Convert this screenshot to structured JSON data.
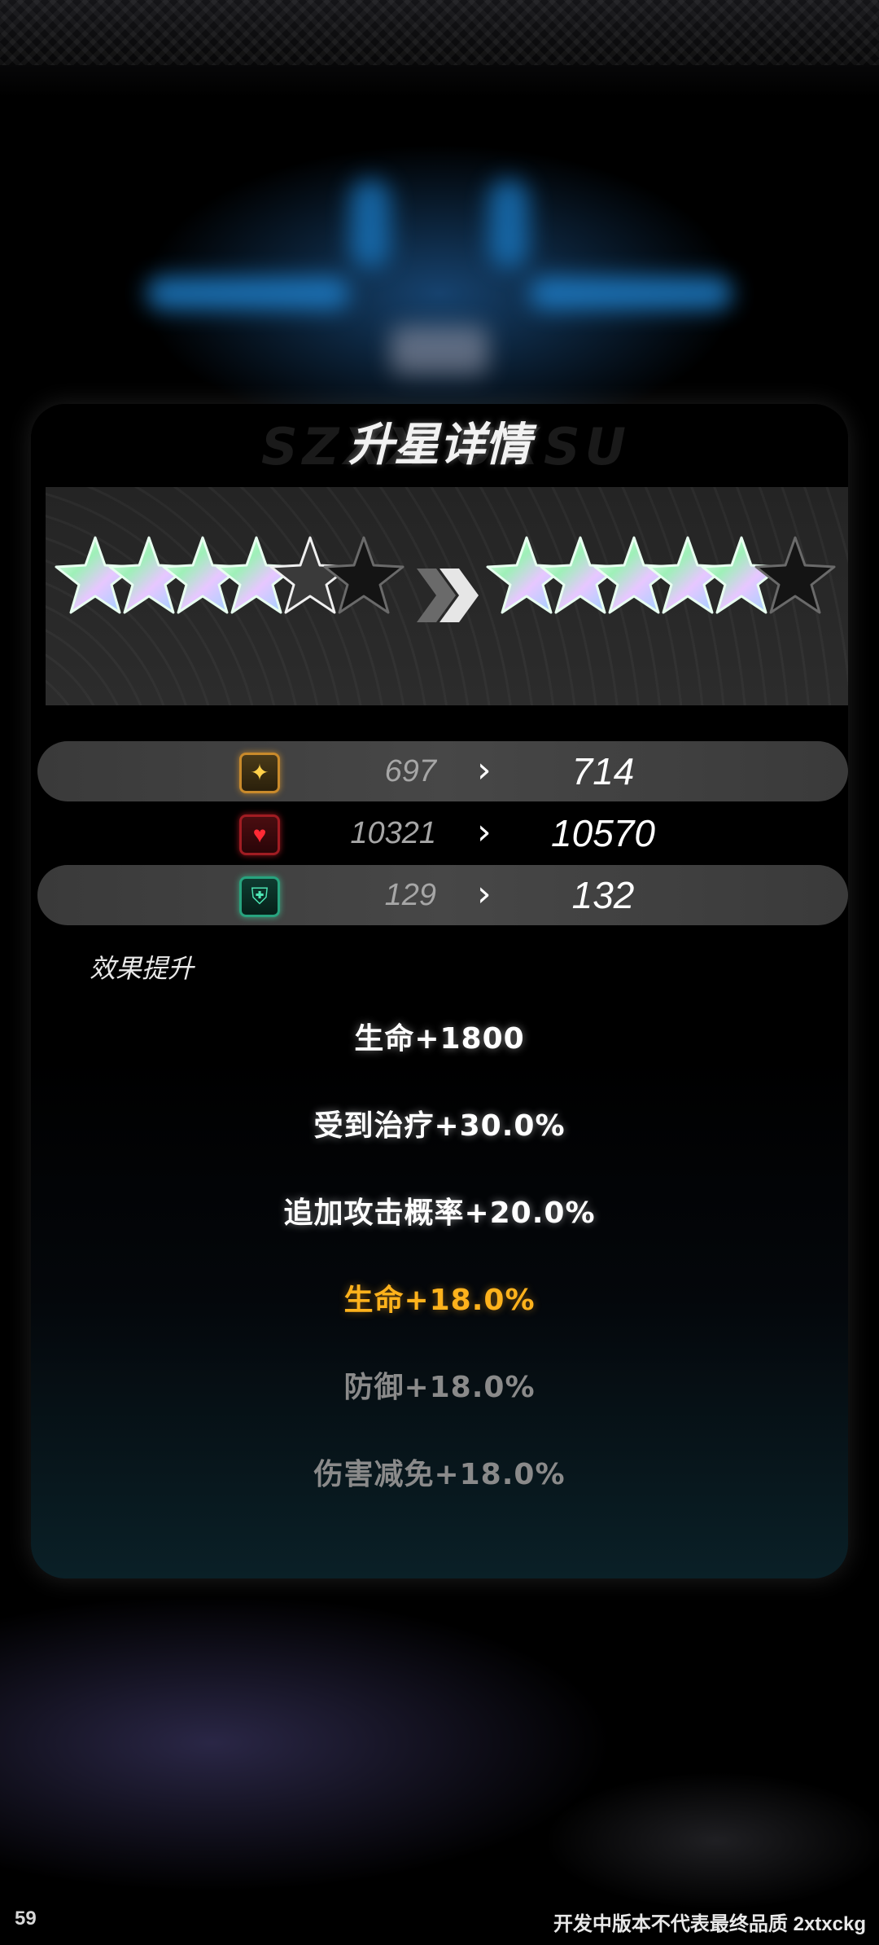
{
  "dialog": {
    "title": "升星详情",
    "title_ghost": "SZXX UXSU"
  },
  "stars": {
    "max": 6,
    "before_filled": 4,
    "before_outlined": 1,
    "after_filled": 5
  },
  "stats": [
    {
      "icon": "sparkle-icon",
      "old": "697",
      "new": "714"
    },
    {
      "icon": "heart-icon",
      "old": "10321",
      "new": "10570"
    },
    {
      "icon": "shield-icon",
      "old": "129",
      "new": "132"
    }
  ],
  "effects_heading": "效果提升",
  "effects": [
    {
      "text": "生命+1800",
      "state": "active"
    },
    {
      "text": "受到治疗+30.0%",
      "state": "active"
    },
    {
      "text": "追加攻击概率+20.0%",
      "state": "active"
    },
    {
      "text": "生命+18.0%",
      "state": "highlight"
    },
    {
      "text": "防御+18.0%",
      "state": "locked"
    },
    {
      "text": "伤害减免+18.0%",
      "state": "locked"
    }
  ],
  "footer": {
    "fps": "59",
    "notice": "开发中版本不代表最终品质 2xtxckg"
  },
  "colors": {
    "highlight": "#ffb21c",
    "locked": "#8a8a8a",
    "active": "#ffffff"
  }
}
